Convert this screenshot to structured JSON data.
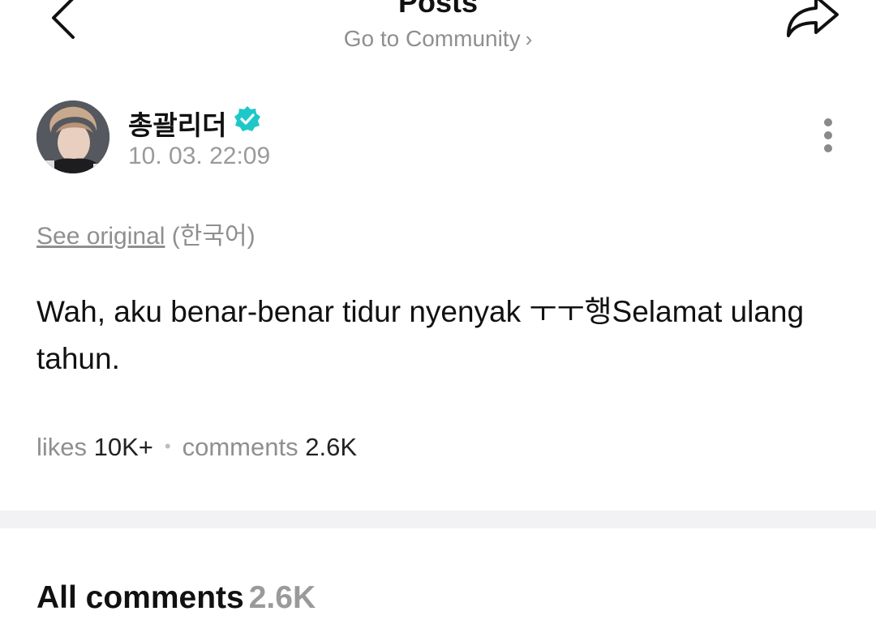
{
  "header": {
    "title": "Posts",
    "community_link": "Go to Community",
    "back_icon": "chevron-left-icon",
    "share_icon": "share-arrow-icon"
  },
  "author": {
    "name": "총괄리더",
    "verified": true,
    "time": "10. 03. 22:09",
    "verified_color": "#1ec8c8"
  },
  "post": {
    "see_original_label": "See original",
    "original_language": "(한국어)",
    "body": "Wah, aku benar-benar tidur nyenyak ㅜㅜ행Selamat ulang tahun."
  },
  "stats": {
    "likes_label": "likes",
    "likes_count": "10K+",
    "comments_label": "comments",
    "comments_count": "2.6K"
  },
  "comments_section": {
    "title": "All comments",
    "count": "2.6K"
  }
}
